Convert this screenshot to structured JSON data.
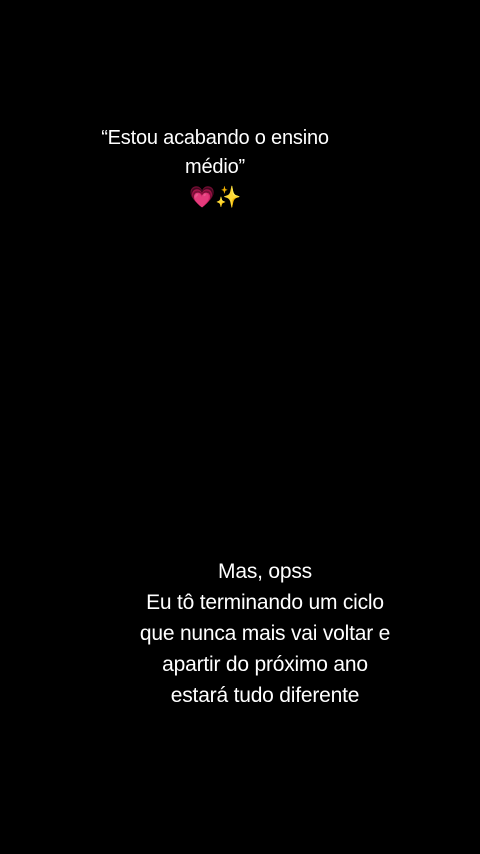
{
  "top_caption": {
    "line1": "“Estou acabando o ensino",
    "line2": "médio”",
    "emoji_heart": "💗",
    "emoji_sparkles": "✨"
  },
  "bottom_caption": {
    "lines": [
      "Mas, opss",
      "Eu tô terminando um ciclo",
      "que nunca mais vai voltar e",
      "apartir do próximo ano",
      "estará tudo diferente"
    ]
  },
  "colors": {
    "background": "#000000",
    "text": "#ffffff",
    "heart": "#ff3b7f",
    "sparkles": "#ffd35a"
  }
}
